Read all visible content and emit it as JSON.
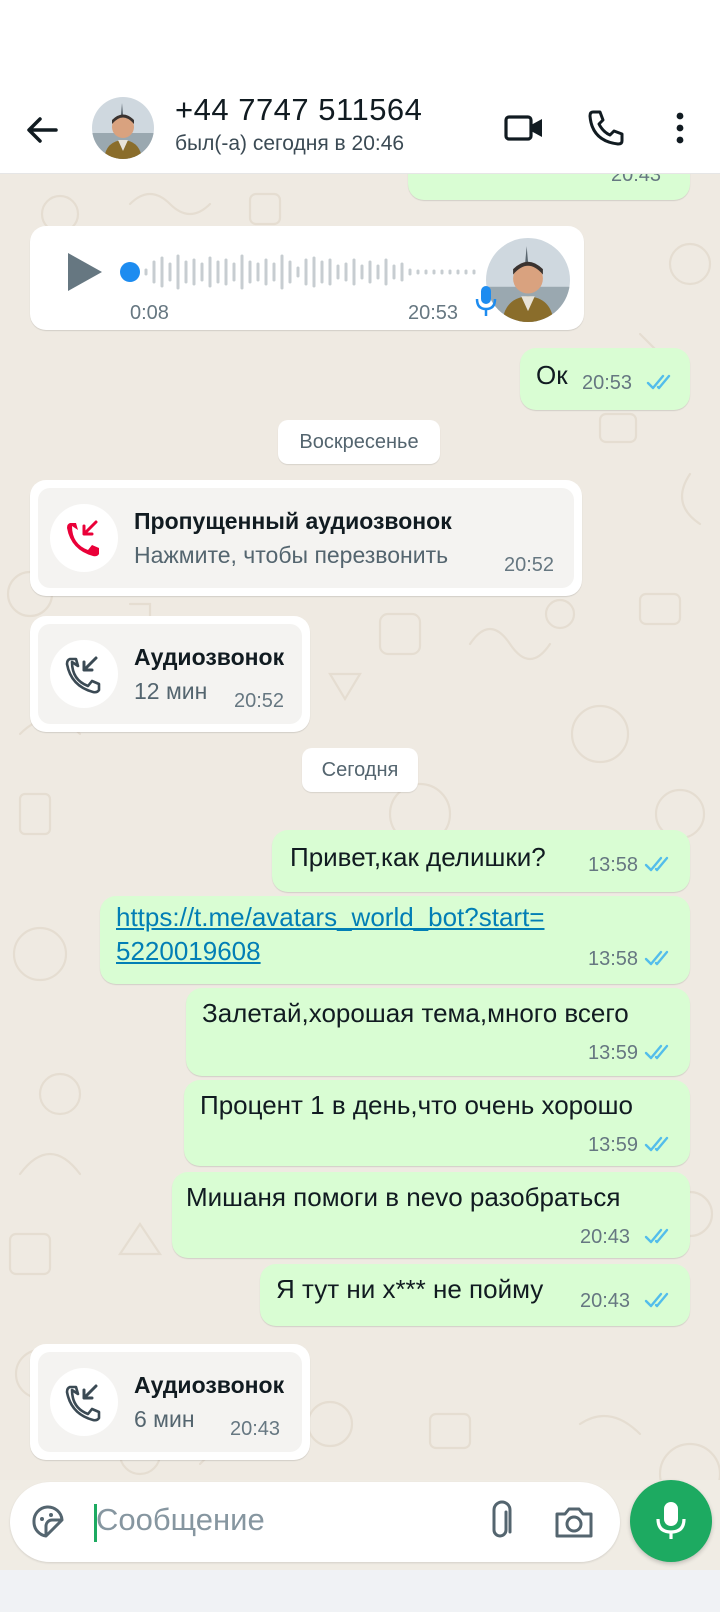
{
  "header": {
    "contact_name": "+44 7747 511564",
    "last_seen": "был(-а) сегодня в 20:46"
  },
  "chat": {
    "top_partial_time": "20:43",
    "voice_message": {
      "duration": "0:08",
      "time": "20:53",
      "progress": 0.0
    },
    "msg_ok": {
      "text": "Ок",
      "time": "20:53"
    },
    "day_sunday": "Воскресенье",
    "missed_call": {
      "title": "Пропущенный аудиозвонок",
      "subtitle": "Нажмите, чтобы перезвонить",
      "time": "20:52"
    },
    "call_1": {
      "title": "Аудиозвонок",
      "duration": "12 мин",
      "time": "20:52"
    },
    "day_today": "Сегодня",
    "msg_1": {
      "text": "Привет,как делишки?",
      "time": "13:58"
    },
    "msg_link": {
      "line1": "https://t.me/avatars_world_bot?start=",
      "line2": "5220019608",
      "time": "13:58"
    },
    "msg_3": {
      "text": "Залетай,хорошая тема,много всего",
      "time": "13:59"
    },
    "msg_4": {
      "text": "Процент 1 в день,что очень хорошо",
      "time": "13:59"
    },
    "msg_5": {
      "text": "Мишаня помоги в nevo разобраться",
      "time": "20:43"
    },
    "msg_6": {
      "text": "Я тут ни х*** не пойму",
      "time": "20:43"
    },
    "call_2": {
      "title": "Аудиозвонок",
      "duration": "6 мин",
      "time": "20:43"
    }
  },
  "composer": {
    "placeholder": "Сообщение"
  },
  "colors": {
    "outgoing_bubble": "#d9fdd3",
    "incoming_bubble": "#ffffff",
    "accent_green": "#1daa61",
    "read_ticks": "#53bdeb",
    "missed_red": "#ea0038",
    "link_blue": "#027eb5"
  },
  "icons": {
    "back": "arrow-left-icon",
    "video": "video-call-icon",
    "phone": "phone-icon",
    "menu": "more-vert-icon",
    "play": "play-icon",
    "mic_badge": "mic-icon",
    "missed": "missed-call-icon",
    "incoming": "incoming-call-icon",
    "sticker": "sticker-icon",
    "attach": "paperclip-icon",
    "camera": "camera-icon",
    "mic": "mic-icon"
  }
}
